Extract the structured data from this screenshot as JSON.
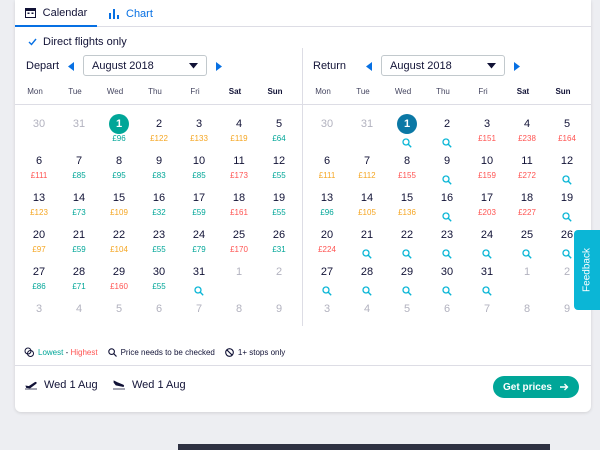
{
  "tabs": [
    {
      "label": "Calendar"
    },
    {
      "label": "Chart"
    }
  ],
  "options": {
    "direct_label": "Direct flights only",
    "direct_checked": true
  },
  "weekdays": [
    "Mon",
    "Tue",
    "Wed",
    "Thu",
    "Fri",
    "Sat",
    "Sun"
  ],
  "depart": {
    "label": "Depart",
    "month": "August 2018",
    "selected": "1",
    "days": [
      {
        "d": "30",
        "dim": true
      },
      {
        "d": "31",
        "dim": true
      },
      {
        "d": "1",
        "p": "£96",
        "c": "g"
      },
      {
        "d": "2",
        "p": "£122",
        "c": "o"
      },
      {
        "d": "3",
        "p": "£133",
        "c": "o"
      },
      {
        "d": "4",
        "p": "£119",
        "c": "o"
      },
      {
        "d": "5",
        "p": "£64",
        "c": "g"
      },
      {
        "d": "6",
        "p": "£111",
        "c": "r"
      },
      {
        "d": "7",
        "p": "£85",
        "c": "g"
      },
      {
        "d": "8",
        "p": "£95",
        "c": "g"
      },
      {
        "d": "9",
        "p": "£83",
        "c": "g"
      },
      {
        "d": "10",
        "p": "£85",
        "c": "g"
      },
      {
        "d": "11",
        "p": "£173",
        "c": "r"
      },
      {
        "d": "12",
        "p": "£55",
        "c": "g"
      },
      {
        "d": "13",
        "p": "£123",
        "c": "o"
      },
      {
        "d": "14",
        "p": "£73",
        "c": "g"
      },
      {
        "d": "15",
        "p": "£109",
        "c": "o"
      },
      {
        "d": "16",
        "p": "£32",
        "c": "g"
      },
      {
        "d": "17",
        "p": "£59",
        "c": "g"
      },
      {
        "d": "18",
        "p": "£161",
        "c": "r"
      },
      {
        "d": "19",
        "p": "£55",
        "c": "g"
      },
      {
        "d": "20",
        "p": "£97",
        "c": "o"
      },
      {
        "d": "21",
        "p": "£59",
        "c": "g"
      },
      {
        "d": "22",
        "p": "£104",
        "c": "o"
      },
      {
        "d": "23",
        "p": "£55",
        "c": "g"
      },
      {
        "d": "24",
        "p": "£79",
        "c": "g"
      },
      {
        "d": "25",
        "p": "£170",
        "c": "r"
      },
      {
        "d": "26",
        "p": "£31",
        "c": "g"
      },
      {
        "d": "27",
        "p": "£86",
        "c": "g"
      },
      {
        "d": "28",
        "p": "£71",
        "c": "g"
      },
      {
        "d": "29",
        "p": "£160",
        "c": "r"
      },
      {
        "d": "30",
        "p": "£55",
        "c": "g"
      },
      {
        "d": "31",
        "q": true
      },
      {
        "d": "1",
        "dim": true
      },
      {
        "d": "2",
        "dim": true
      },
      {
        "d": "3",
        "dim": true
      },
      {
        "d": "4",
        "dim": true
      },
      {
        "d": "5",
        "dim": true
      },
      {
        "d": "6",
        "dim": true
      },
      {
        "d": "7",
        "dim": true
      },
      {
        "d": "8",
        "dim": true
      },
      {
        "d": "9",
        "dim": true
      }
    ]
  },
  "return": {
    "label": "Return",
    "month": "August 2018",
    "selected": "1",
    "days": [
      {
        "d": "30",
        "dim": true
      },
      {
        "d": "31",
        "dim": true
      },
      {
        "d": "1",
        "q": true
      },
      {
        "d": "2",
        "q": true
      },
      {
        "d": "3",
        "p": "£151",
        "c": "r"
      },
      {
        "d": "4",
        "p": "£238",
        "c": "r"
      },
      {
        "d": "5",
        "p": "£164",
        "c": "r"
      },
      {
        "d": "6",
        "p": "£111",
        "c": "o"
      },
      {
        "d": "7",
        "p": "£112",
        "c": "o"
      },
      {
        "d": "8",
        "p": "£155",
        "c": "r"
      },
      {
        "d": "9",
        "q": true
      },
      {
        "d": "10",
        "p": "£159",
        "c": "r"
      },
      {
        "d": "11",
        "p": "£272",
        "c": "r"
      },
      {
        "d": "12",
        "q": true
      },
      {
        "d": "13",
        "p": "£96",
        "c": "g"
      },
      {
        "d": "14",
        "p": "£105",
        "c": "o"
      },
      {
        "d": "15",
        "p": "£136",
        "c": "o"
      },
      {
        "d": "16",
        "q": true
      },
      {
        "d": "17",
        "p": "£203",
        "c": "r"
      },
      {
        "d": "18",
        "p": "£227",
        "c": "r"
      },
      {
        "d": "19",
        "q": true
      },
      {
        "d": "20",
        "p": "£224",
        "c": "r"
      },
      {
        "d": "21",
        "q": true
      },
      {
        "d": "22",
        "q": true
      },
      {
        "d": "23",
        "q": true
      },
      {
        "d": "24",
        "q": true
      },
      {
        "d": "25",
        "q": true
      },
      {
        "d": "26",
        "q": true
      },
      {
        "d": "27",
        "q": true
      },
      {
        "d": "28",
        "q": true
      },
      {
        "d": "29",
        "q": true
      },
      {
        "d": "30",
        "q": true
      },
      {
        "d": "31",
        "q": true
      },
      {
        "d": "1",
        "dim": true
      },
      {
        "d": "2",
        "dim": true
      },
      {
        "d": "3",
        "dim": true
      },
      {
        "d": "4",
        "dim": true
      },
      {
        "d": "5",
        "dim": true
      },
      {
        "d": "6",
        "dim": true
      },
      {
        "d": "7",
        "dim": true
      },
      {
        "d": "8",
        "dim": true
      },
      {
        "d": "9",
        "dim": true
      }
    ]
  },
  "legend": {
    "lowest": "Lowest",
    "dash": " - ",
    "highest": "Highest",
    "check": "Price needs to be checked",
    "stops": "1+ stops only"
  },
  "summary": {
    "outbound": "Wed 1 Aug",
    "inbound": "Wed 1 Aug"
  },
  "cta": {
    "label": "Get prices"
  },
  "feedback": {
    "label": "Feedback"
  },
  "colors": {
    "accent": "#00a698",
    "brand_blue": "#0770e3",
    "return_selected": "#0b78a5",
    "price_low": "#00a698",
    "price_mid": "#f5a623",
    "price_high": "#ff5452",
    "feedback": "#0bb6d6"
  }
}
